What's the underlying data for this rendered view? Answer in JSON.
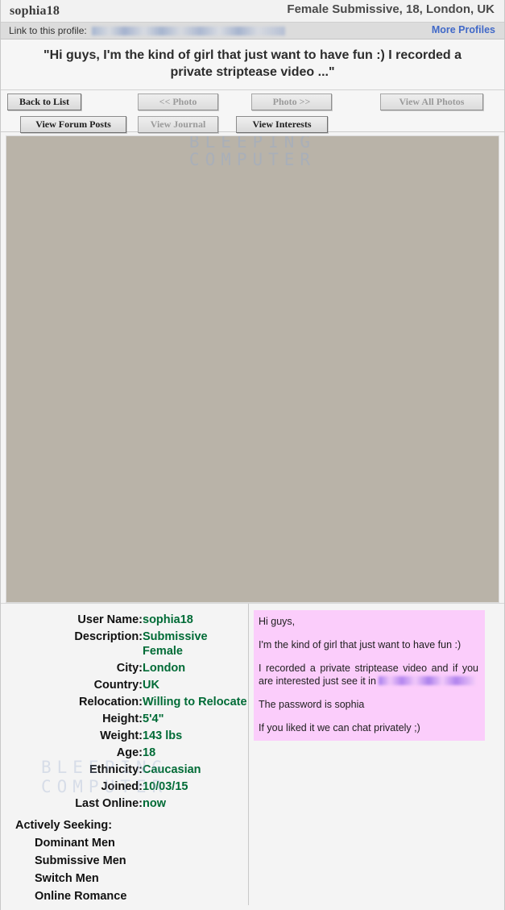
{
  "header": {
    "username": "sophia18",
    "headline": "Female Submissive, 18,  London, UK"
  },
  "linkbar": {
    "label": "Link to this profile:",
    "url_redacted": "",
    "more_profiles": "More Profiles"
  },
  "quote": "\"Hi guys, I'm the kind of girl that just want to have fun :) I recorded a private striptease video ...\"",
  "toolbar": {
    "back_to_list": "Back to List",
    "prev_photo": "<< Photo",
    "next_photo": "Photo >>",
    "view_all_photos": "View All Photos",
    "view_forum_posts": "View Forum Posts",
    "view_journal": "View Journal",
    "view_interests": "View Interests"
  },
  "photo": {
    "watermark_line1": "BLEEPING",
    "watermark_line2": "COMPUTER"
  },
  "watermark2": {
    "line1": "BLEEPING",
    "line2": "COMPUTER"
  },
  "details": [
    {
      "key": "User Name:",
      "value": "sophia18"
    },
    {
      "key": "Description:",
      "value": "Submissive Female"
    },
    {
      "key": "City:",
      "value": "London"
    },
    {
      "key": "Country:",
      "value": "UK"
    },
    {
      "key": "Relocation:",
      "value": "Willing to Relocate"
    },
    {
      "key": "Height:",
      "value": "5'4\""
    },
    {
      "key": "Weight:",
      "value": "143 lbs"
    },
    {
      "key": "Age:",
      "value": "18"
    },
    {
      "key": "Ethnicity:",
      "value": "Caucasian"
    },
    {
      "key": "Joined:",
      "value": "10/03/15"
    },
    {
      "key": "Last Online:",
      "value": "now"
    }
  ],
  "seeking": {
    "heading": "Actively Seeking:",
    "items": [
      "Dominant Men",
      "Submissive Men",
      "Switch Men",
      "Online Romance"
    ]
  },
  "message": {
    "greeting": "Hi guys,",
    "line2": "I'm the kind of girl that just want to have fun :)",
    "line3_a": "I recorded a private striptease video and if you are interested just see it in",
    "line3_url_redacted": "",
    "line4": "The password is sophia",
    "line5": "If you liked it we can chat privately ;)"
  },
  "colors": {
    "value_green": "#006b36",
    "link_blue": "#4169c8",
    "pink_bg": "#fbcdfb",
    "linkbar_bg": "#dcdcdc",
    "page_bg": "#f4f4f4"
  }
}
